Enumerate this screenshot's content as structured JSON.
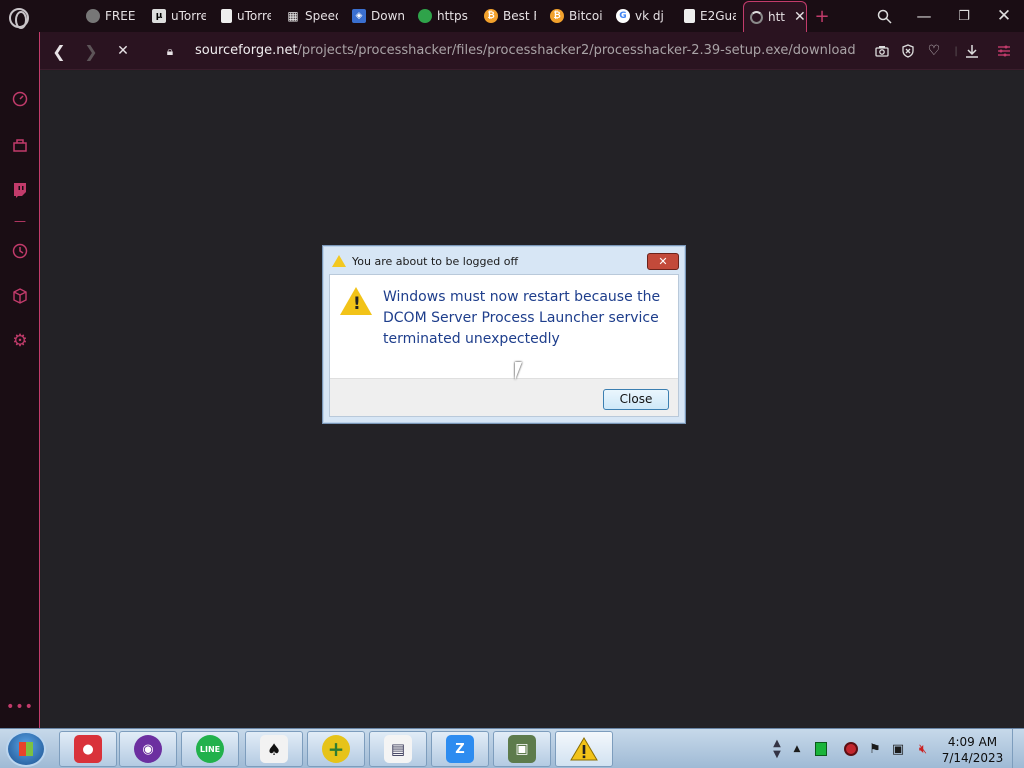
{
  "tabs": [
    {
      "label": "FREE I",
      "icon": "ghost-icon"
    },
    {
      "label": "uTorre",
      "icon": "utorrent-icon"
    },
    {
      "label": "uTorre",
      "icon": "document-icon"
    },
    {
      "label": "Speed",
      "icon": "grid-icon"
    },
    {
      "label": "Down",
      "icon": "shield-icon"
    },
    {
      "label": "https:",
      "icon": "globe-icon"
    },
    {
      "label": "Best F",
      "icon": "bitcoin-icon"
    },
    {
      "label": "Bitcoi",
      "icon": "bitcoin-icon"
    },
    {
      "label": "vk dj c",
      "icon": "google-icon"
    },
    {
      "label": "E2Gua",
      "icon": "document-icon"
    },
    {
      "label": "htt",
      "icon": "loading-spinner-icon"
    }
  ],
  "address": {
    "domain": "sourceforge.net",
    "path": "/projects/processhacker/files/processhacker2/processhacker-2.39-setup.exe/download"
  },
  "dialog": {
    "title": "You are about to be logged off",
    "message": "Windows must now restart because the DCOM Server Process Launcher service terminated unexpectedly",
    "close_label": "Close"
  },
  "clock": {
    "time": "4:09 AM",
    "date": "7/14/2023"
  },
  "colors": {
    "accent": "#c23b6b",
    "browser_bg": "#1a0d14",
    "content_bg": "#232226",
    "dialog_text": "#1e3e8c"
  }
}
